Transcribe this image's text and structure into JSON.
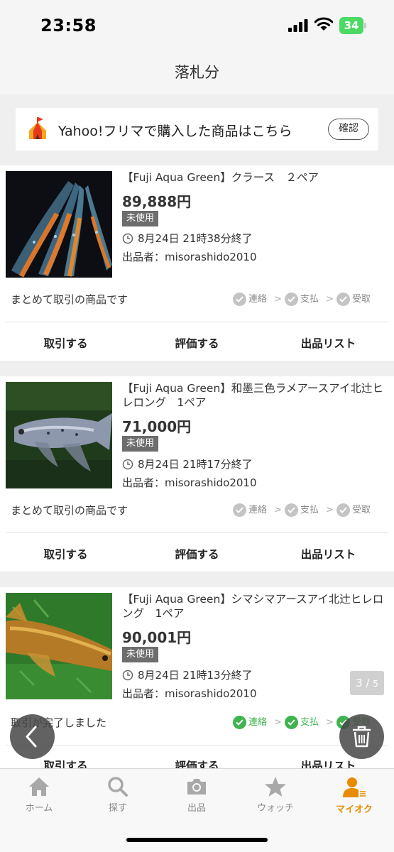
{
  "status": {
    "time": "23:58",
    "battery": "34"
  },
  "header": {
    "title": "落札分"
  },
  "banner": {
    "text": "Yahoo!フリマで購入した商品はこちら",
    "button": "確認"
  },
  "items": [
    {
      "title": "【Fuji Aqua Green】クラース　２ペア",
      "price": "89,888円",
      "condition": "未使用",
      "end_time": "8月24日 21時38分終了",
      "seller": "出品者：misorashido2010",
      "note": "まとめて取引の商品です",
      "steps": [
        "連絡",
        "支払",
        "受取"
      ],
      "steps_complete": false,
      "actions": [
        "取引する",
        "評価する",
        "出品リスト"
      ]
    },
    {
      "title": "【Fuji Aqua Green】和墨三色ラメアースアイ北辻ヒレロング　1ペア",
      "price": "71,000円",
      "condition": "未使用",
      "end_time": "8月24日 21時17分終了",
      "seller": "出品者：misorashido2010",
      "note": "まとめて取引の商品です",
      "steps": [
        "連絡",
        "支払",
        "受取"
      ],
      "steps_complete": false,
      "actions": [
        "取引する",
        "評価する",
        "出品リスト"
      ]
    },
    {
      "title": "【Fuji Aqua Green】シマシマアースアイ北辻ヒレロング　1ペア",
      "price": "90,001円",
      "condition": "未使用",
      "end_time": "8月24日 21時13分終了",
      "seller": "出品者：misorashido2010",
      "note": "取引が完了しました",
      "steps": [
        "連絡",
        "支払",
        "受取"
      ],
      "steps_complete": true,
      "actions": [
        "取引する",
        "評価する",
        "出品リスト"
      ]
    }
  ],
  "pager": {
    "current": "3",
    "total": "5"
  },
  "tabs": [
    {
      "label": "ホーム",
      "icon": "home-icon",
      "active": false
    },
    {
      "label": "探す",
      "icon": "search-icon",
      "active": false
    },
    {
      "label": "出品",
      "icon": "camera-icon",
      "active": false
    },
    {
      "label": "ウォッチ",
      "icon": "star-icon",
      "active": false
    },
    {
      "label": "マイオク",
      "icon": "user-icon",
      "active": true
    }
  ],
  "colors": {
    "accent": "#e98b00",
    "complete": "#3fb34f",
    "price": "#333333",
    "badge": "#6d6d6d"
  }
}
